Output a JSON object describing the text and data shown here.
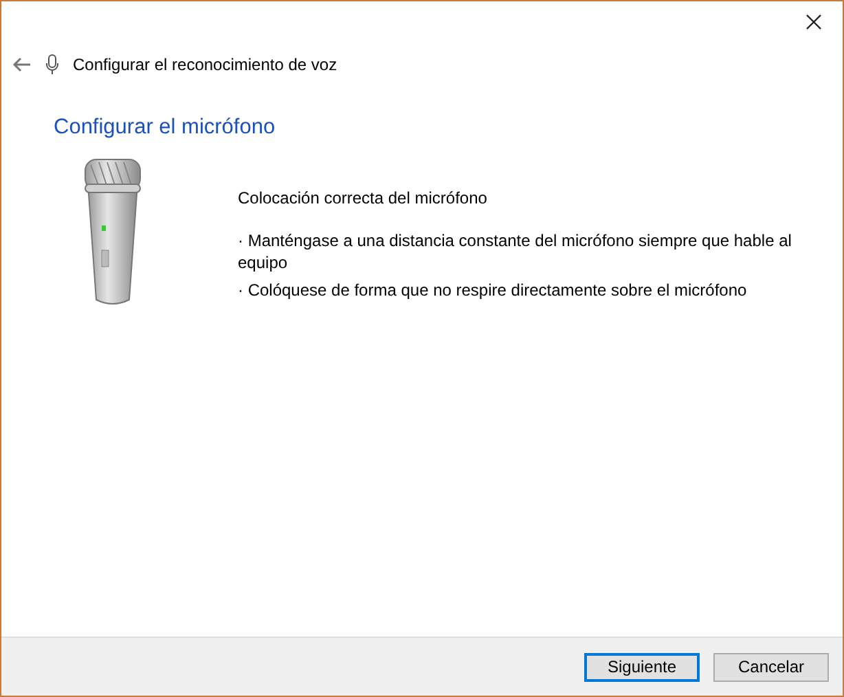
{
  "window": {
    "title": "Configurar el reconocimiento de voz"
  },
  "heading": "Configurar el micrófono",
  "section_title": "Colocación correcta del micrófono",
  "tips": [
    "· Manténgase a una distancia constante del micrófono siempre que hable al equipo",
    "· Colóquese de forma que no respire directamente sobre el micrófono"
  ],
  "buttons": [
    {
      "label": "Siguiente",
      "selected": true
    },
    {
      "label": "Cancelar",
      "selected": false
    }
  ]
}
